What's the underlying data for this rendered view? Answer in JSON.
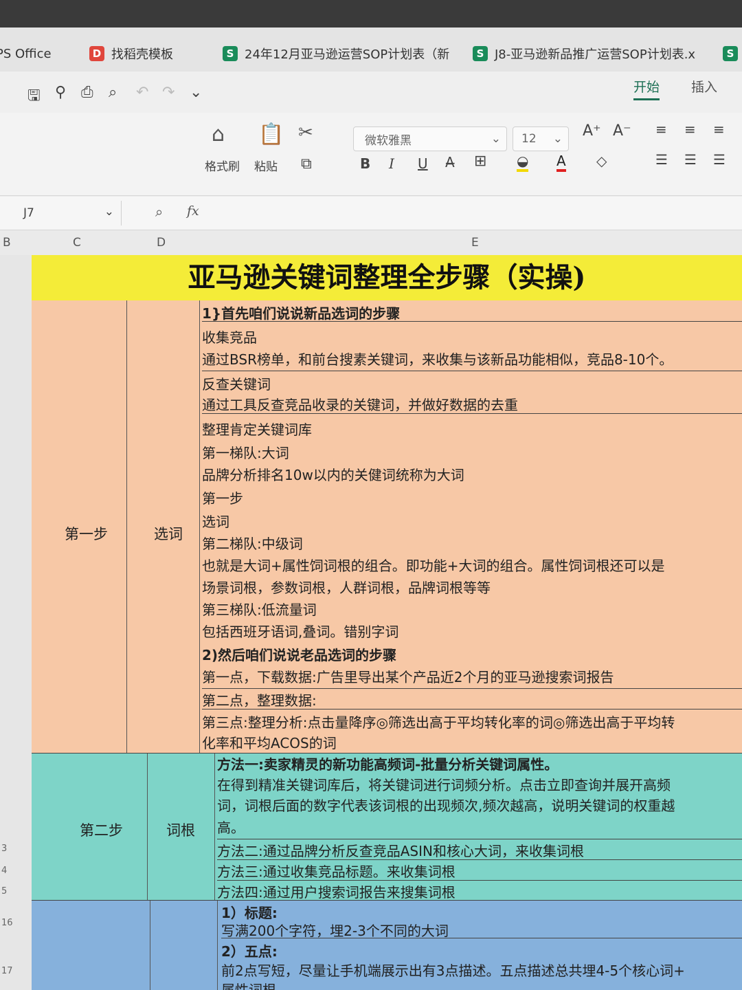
{
  "tabs": [
    {
      "icon": "",
      "label": "PS Office"
    },
    {
      "icon": "D",
      "label": "找稻壳模板"
    },
    {
      "icon": "S",
      "label": "24年12月亚马逊运营SOP计划表（新"
    },
    {
      "icon": "S",
      "label": "J8-亚马逊新品推广运营SOP计划表.x"
    },
    {
      "icon": "S",
      "label": ""
    }
  ],
  "menu": {
    "start": "开始",
    "insert": "插入"
  },
  "ribbon": {
    "format_painter": "格式刷",
    "paste": "粘贴",
    "font_name": "微软雅黑",
    "font_size": "12",
    "bold": "B",
    "italic": "I",
    "underline": "U"
  },
  "formula_bar": {
    "cell_ref": "J7",
    "fx": "fx",
    "value": ""
  },
  "columns": [
    "B",
    "C",
    "D",
    "E"
  ],
  "row_numbers": [
    "3",
    "4",
    "5",
    "16",
    "17"
  ],
  "sheet": {
    "title": "亚马逊关键词整理全步骤（实操)",
    "step1": {
      "step": "第一步",
      "name": "选词",
      "lines": [
        "1}首先咱们说说新品选词的步骤",
        "收集竞品",
        "通过BSR榜单，和前台搜素关键词，来收集与该新品功能相似，竞品8-10个。",
        "反查关键词",
        "通过工具反查竞品收录的关键词，并做好数据的去重",
        "整理肯定关键词库",
        "第一梯队:大词",
        "品牌分析排名10w以内的关健词统称为大词",
        "第一步",
        "选词",
        "第二梯队:中级词",
        "也就是大词+属性饲词根的组合。即功能+大词的组合。属性饲词根还可以是",
        "场景词根，参数词根，人群词根，品牌词根等等",
        "第三梯队:低流量词",
        "包括西班牙语词,叠词。错别字词",
        "2)然后咱们说说老品选词的步骤",
        "第一点，下载数据:广告里导出某个产品近2个月的亚马逊搜索词报告",
        "第二点，整理数据:",
        "第三点:整理分析:点击量降序◎筛选出高于平均转化率的词◎筛选出高于平均转",
        "化率和平均ACOS的词"
      ]
    },
    "step2": {
      "step": "第二步",
      "name": "词根",
      "lines": [
        "方法一:卖家精灵的新功能高频词-批量分析关键词属性。",
        "在得到精准关键词库后，将关键词进行词频分析。点击立即查询并展开高频",
        "词，词根后面的数字代表该词根的出现频次,频次越高，说明关键词的权重越",
        "高。",
        "方法二:通过品牌分析反查竞品ASIN和核心大词，来收集词根",
        "方法三:通过收集竞品标题。来收集词根",
        "方法四:通过用户搜索词报告来搜集词根"
      ]
    },
    "step3": {
      "lines": [
        "1）标题:",
        "写满200个字符，埋2-3个不同的大词",
        "2）五点:",
        "前2点写短，尽量让手机端展示出有3点描述。五点描述总共埋4-5个核心词+",
        "属性词根"
      ]
    }
  }
}
